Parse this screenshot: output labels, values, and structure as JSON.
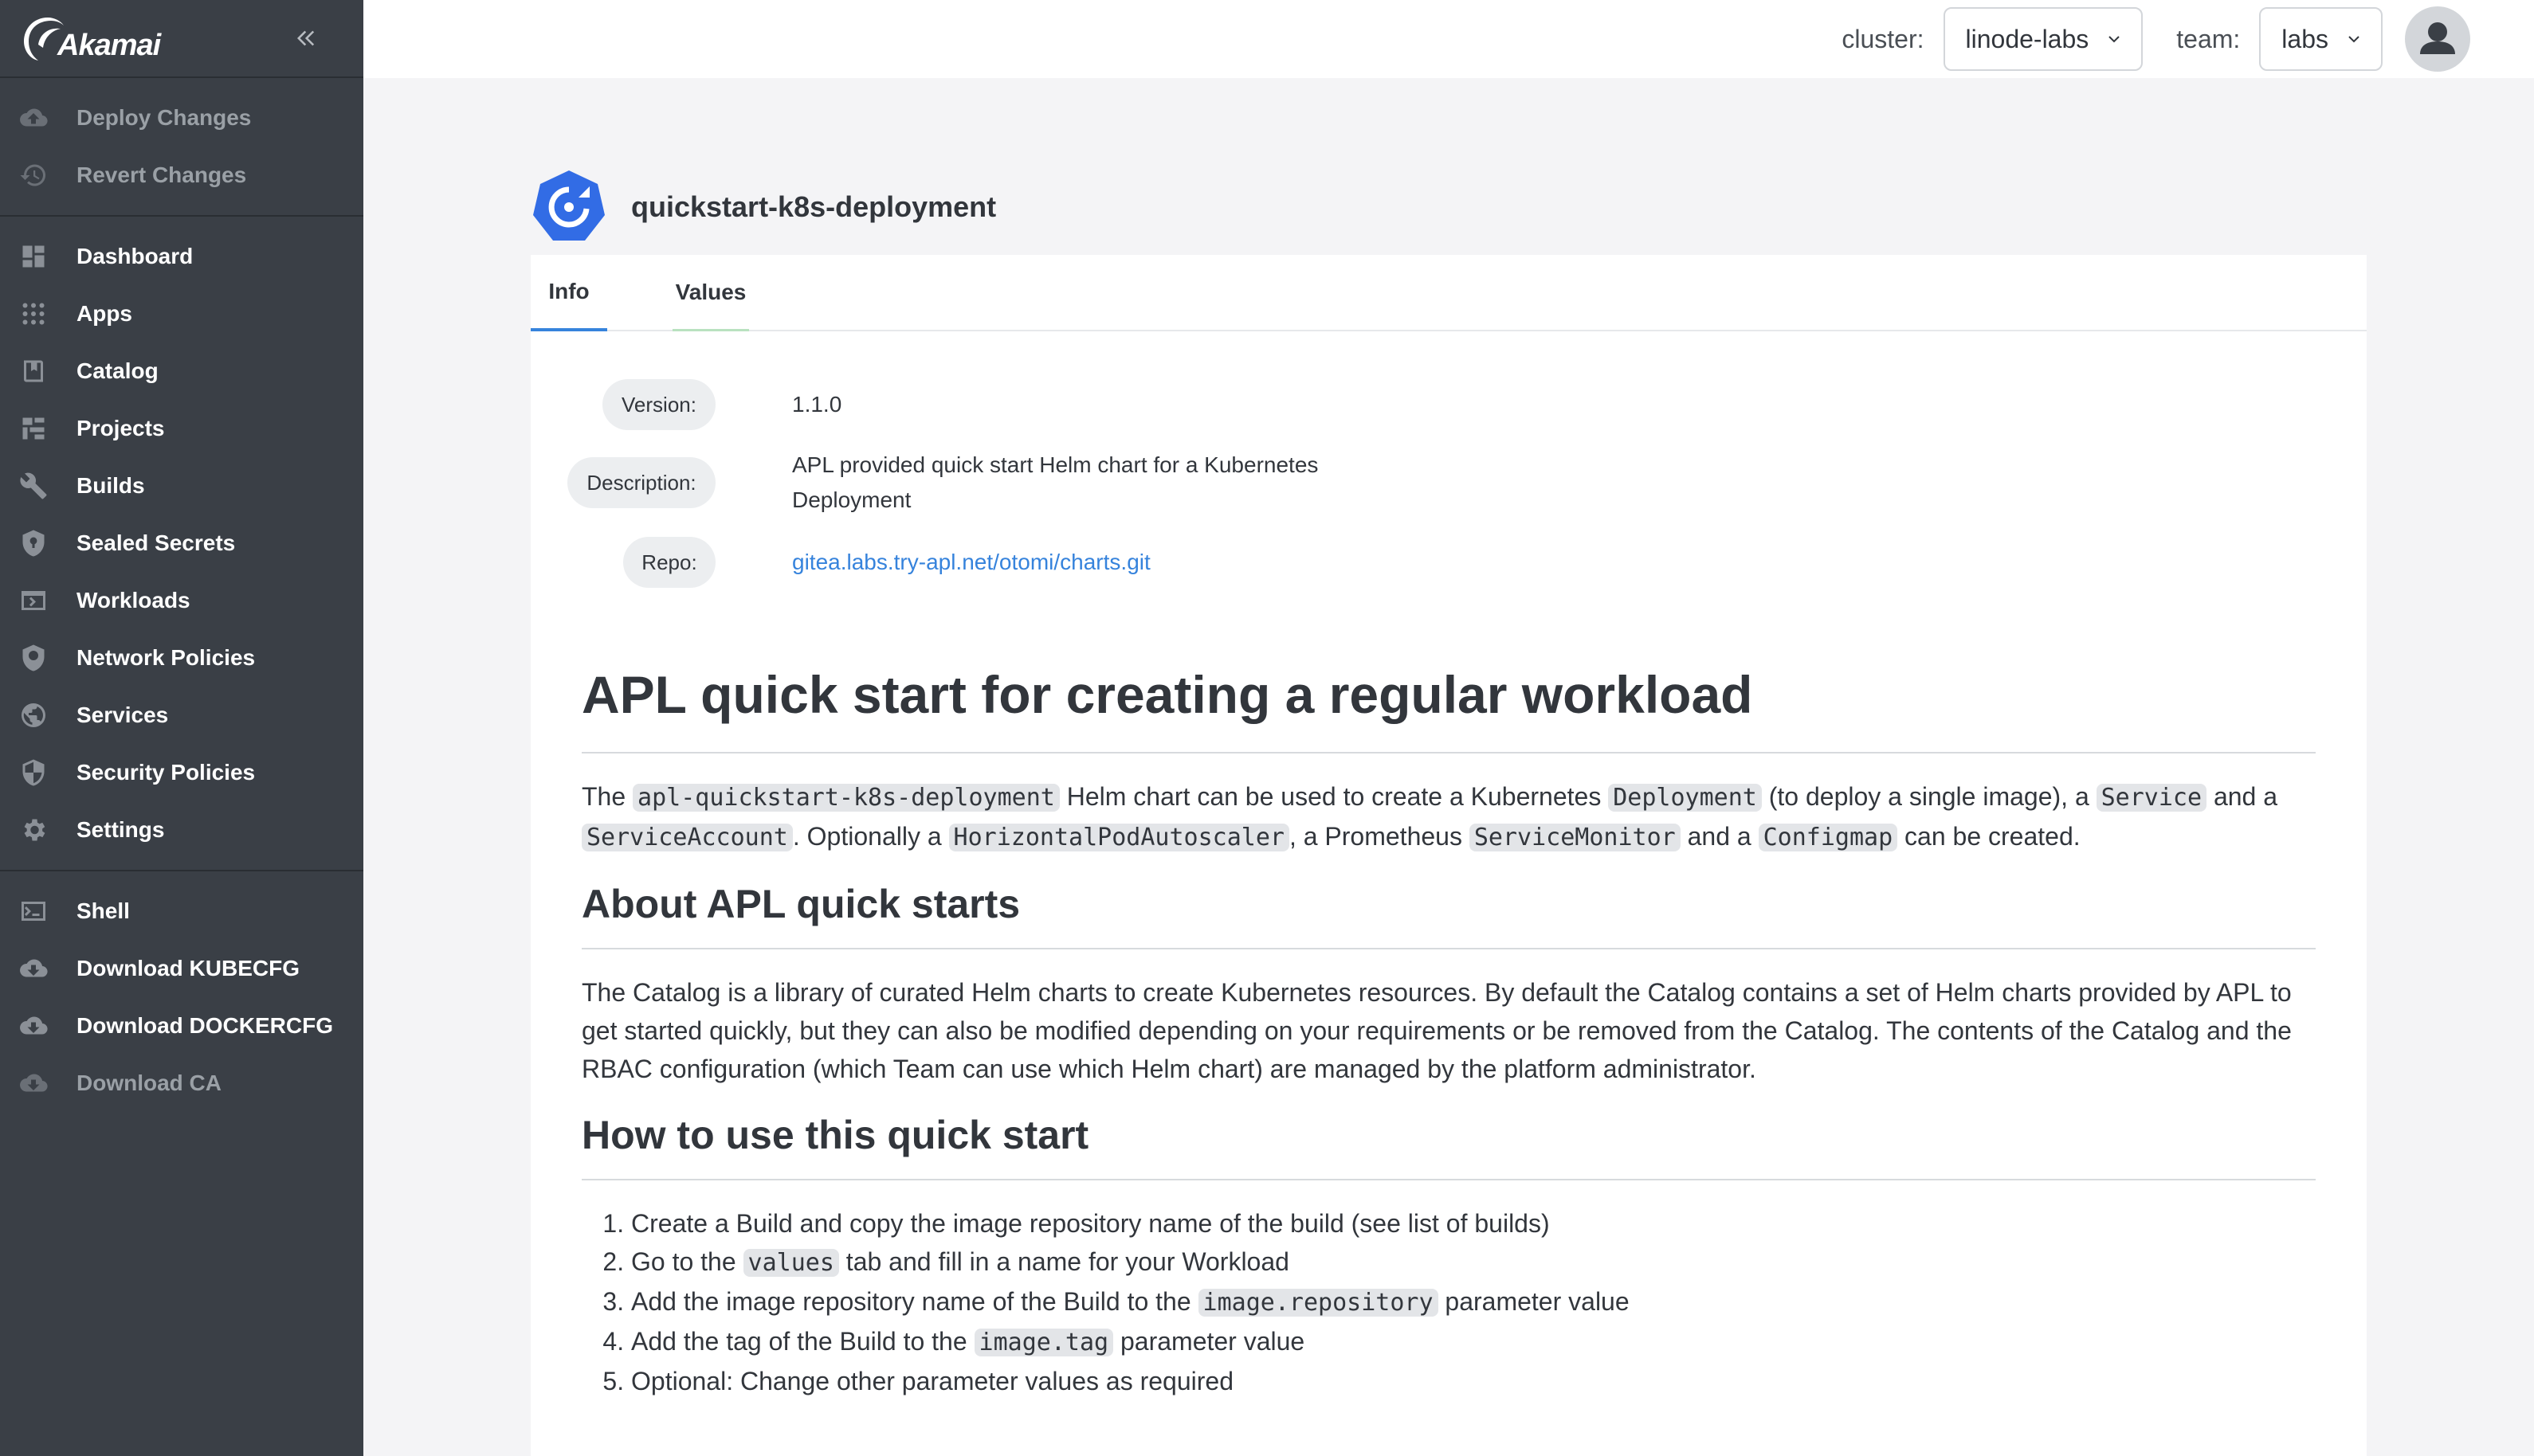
{
  "sidebar": {
    "brand": "Akamai",
    "top_actions": [
      {
        "label": "Deploy Changes",
        "icon": "cloud-upload-icon"
      },
      {
        "label": "Revert Changes",
        "icon": "history-icon"
      }
    ],
    "nav": [
      {
        "label": "Dashboard",
        "icon": "dashboard-icon"
      },
      {
        "label": "Apps",
        "icon": "apps-grid-icon"
      },
      {
        "label": "Catalog",
        "icon": "book-icon"
      },
      {
        "label": "Projects",
        "icon": "projects-icon"
      },
      {
        "label": "Builds",
        "icon": "wrench-icon"
      },
      {
        "label": "Sealed Secrets",
        "icon": "shield-lock-icon"
      },
      {
        "label": "Workloads",
        "icon": "workloads-icon"
      },
      {
        "label": "Network Policies",
        "icon": "shield-network-icon"
      },
      {
        "label": "Services",
        "icon": "globe-icon"
      },
      {
        "label": "Security Policies",
        "icon": "shield-half-icon"
      },
      {
        "label": "Settings",
        "icon": "gear-icon"
      }
    ],
    "bottom": [
      {
        "label": "Shell",
        "icon": "terminal-icon"
      },
      {
        "label": "Download KUBECFG",
        "icon": "cloud-download-icon"
      },
      {
        "label": "Download DOCKERCFG",
        "icon": "cloud-download-icon"
      },
      {
        "label": "Download CA",
        "icon": "cloud-download-icon"
      }
    ]
  },
  "topbar": {
    "cluster_label": "cluster:",
    "cluster_value": "linode-labs",
    "team_label": "team:",
    "team_value": "labs"
  },
  "app": {
    "title": "quickstart-k8s-deployment",
    "tabs": [
      "Info",
      "Values"
    ],
    "meta": {
      "version_label": "Version:",
      "version_value": "1.1.0",
      "description_label": "Description:",
      "description_line1": "APL provided quick start Helm chart for a Kubernetes",
      "description_line2": "Deployment",
      "repo_label": "Repo:",
      "repo_value": "gitea.labs.try-apl.net/otomi/charts.git"
    }
  },
  "readme": {
    "h1": "APL quick start for creating a regular workload",
    "intro": {
      "t1": "The ",
      "c1": "apl-quickstart-k8s-deployment",
      "t2": " Helm chart can be used to create a Kubernetes ",
      "c2": "Deployment",
      "t3": " (to deploy a single image), a ",
      "c3": "Service",
      "t4": " and a ",
      "c4": "ServiceAccount",
      "t5": ". Optionally a ",
      "c5": "HorizontalPodAutoscaler",
      "t6": ", a Prometheus ",
      "c6": "ServiceMonitor",
      "t7": " and a ",
      "c7": "Configmap",
      "t8": " can be created."
    },
    "h2_about": "About APL quick starts",
    "about": "The Catalog is a library of curated Helm charts to create Kubernetes resources. By default the Catalog contains a set of Helm charts provided by APL to get started quickly, but they can also be modified depending on your requirements or be removed from the Catalog. The contents of the Catalog and the RBAC configuration (which Team can use which Helm chart) are managed by the platform administrator.",
    "h2_howto": "How to use this quick start",
    "steps": {
      "s1": "Create a Build and copy the image repository name of the build (see list of builds)",
      "s2a": "Go to the ",
      "s2c": "values",
      "s2b": " tab and fill in a name for your Workload",
      "s3a": "Add the image repository name of the Build to the ",
      "s3c": "image.repository",
      "s3b": " parameter value",
      "s4a": "Add the tag of the Build to the ",
      "s4c": "image.tag",
      "s4b": " parameter value",
      "s5": "Optional: Change other parameter values as required"
    }
  },
  "colors": {
    "sidebar_bg": "#3a3f46",
    "accent_blue": "#3683dc",
    "app_logo_blue": "#326ce5"
  }
}
